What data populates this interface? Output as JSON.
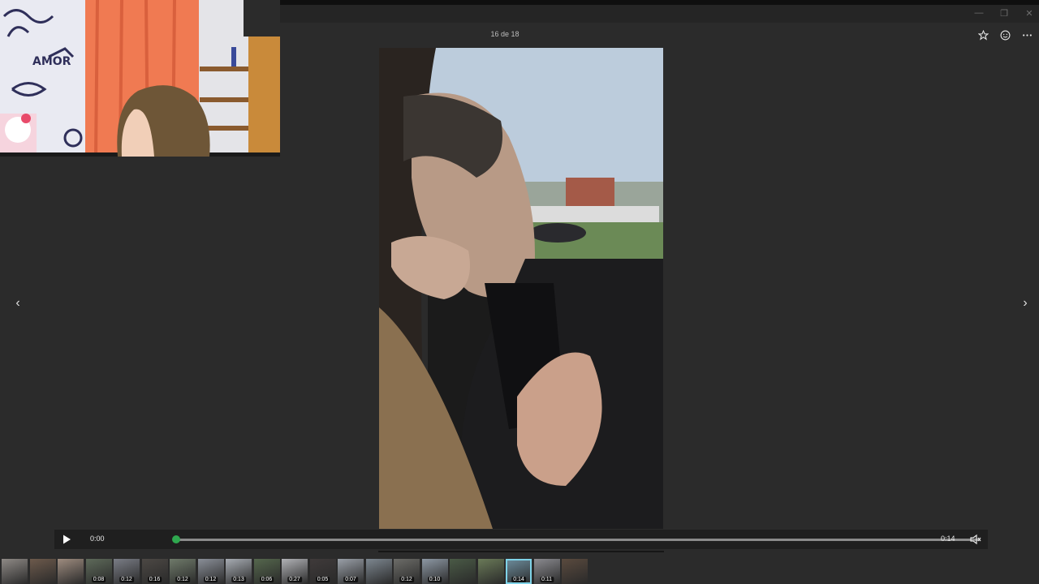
{
  "viewer": {
    "counter": "16 de 18",
    "window_buttons": {
      "minimize": "—",
      "restore": "❐",
      "close": "✕"
    },
    "icons": {
      "favorite": "star-icon",
      "reaction": "smiley-icon",
      "more": "more-icon",
      "prev": "chevron-left-icon",
      "next": "chevron-right-icon"
    }
  },
  "player": {
    "current_time": "0:00",
    "duration": "0:14",
    "progress": 0.0,
    "accent": "#2fa84f",
    "icons": {
      "play": "play-icon",
      "volume": "mute-icon"
    }
  },
  "filmstrip": {
    "durations": [
      "",
      "",
      "",
      "0:08",
      "0:12",
      "0:16",
      "0:12",
      "0:12",
      "0:13",
      "0:06",
      "0:27",
      "0:05",
      "0:07",
      "",
      "0:12",
      "0:10",
      "",
      "",
      "0:14",
      "0:11",
      ""
    ],
    "selected_index": 18
  }
}
